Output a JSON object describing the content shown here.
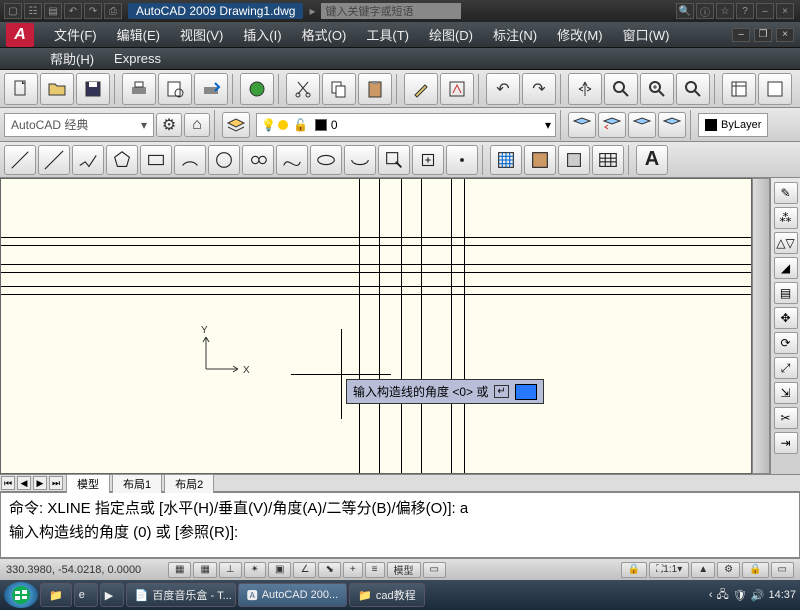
{
  "title": {
    "app": "AutoCAD 2009",
    "file": "Drawing1.dwg"
  },
  "search_placeholder": "键入关键字或短语",
  "menus": {
    "file": "文件(F)",
    "edit": "编辑(E)",
    "view": "视图(V)",
    "insert": "插入(I)",
    "format": "格式(O)",
    "tools": "工具(T)",
    "draw": "绘图(D)",
    "dimension": "标注(N)",
    "modify": "修改(M)",
    "window": "窗口(W)",
    "help": "帮助(H)",
    "express": "Express"
  },
  "workspace": "AutoCAD 经典",
  "layer": {
    "name": "0"
  },
  "linetype": "ByLayer",
  "ucs": {
    "x": "X",
    "y": "Y"
  },
  "tooltip": {
    "text": "输入构造线的角度 <0> 或",
    "iconhint": "↵"
  },
  "tabs": {
    "model": "模型",
    "layout1": "布局1",
    "layout2": "布局2"
  },
  "cmd": {
    "line1": "命令:  XLINE 指定点或 [水平(H)/垂直(V)/角度(A)/二等分(B)/偏移(O)]: a",
    "line2": "输入构造线的角度 (0) 或 [参照(R)]:"
  },
  "status": {
    "coords": "330.3980, -54.0218, 0.0000",
    "snap": "捕捉",
    "grid": "栅格",
    "ortho": "正交",
    "polar": "极轴",
    "osnap": "对象捕捉",
    "otrack": "对象追踪",
    "ducs": "DUCS",
    "dyn": "DYN",
    "lwt": "线宽",
    "model": "模型",
    "scale": "1:1",
    "ann": "▲"
  },
  "taskbar": {
    "items": [
      "百度音乐盒 - T...",
      "AutoCAD 200...",
      "cad教程"
    ],
    "time": "14:37"
  }
}
